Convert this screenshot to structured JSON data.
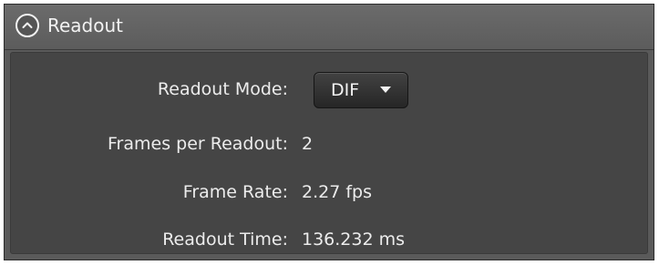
{
  "panel": {
    "title": "Readout",
    "collapse_icon": "chevron-up-circle-icon"
  },
  "fields": {
    "readout_mode": {
      "label": "Readout Mode:",
      "selected": "DIF",
      "dropdown_icon": "caret-down-icon"
    },
    "frames_per_readout": {
      "label": "Frames per Readout:",
      "value": "2"
    },
    "frame_rate": {
      "label": "Frame Rate:",
      "value": "2.27 fps"
    },
    "readout_time": {
      "label": "Readout Time:",
      "value": "136.232 ms"
    }
  },
  "colors": {
    "panel_bg": "#5a5a5a",
    "body_bg": "#454545",
    "text": "#ececec"
  }
}
